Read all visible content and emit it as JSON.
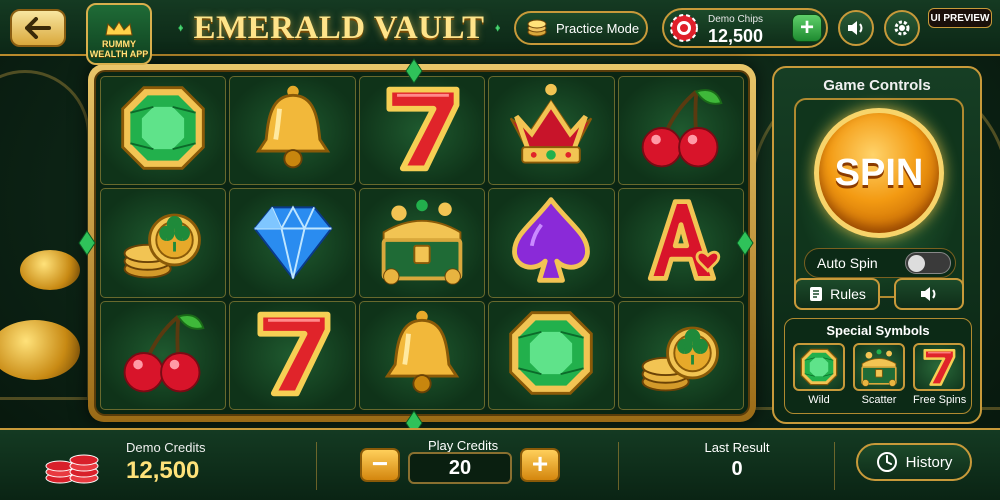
{
  "header": {
    "app_logo_text": "RUMMY WEALTH APP",
    "title": "EMERALD VAULT",
    "practice_label": "Practice Mode",
    "chips_label": "Demo Chips",
    "chips_value": "12,500",
    "preview_badge": "UI PREVIEW"
  },
  "reels": [
    [
      "emerald",
      "bell",
      "seven",
      "crown",
      "cherry"
    ],
    [
      "coins",
      "diamond",
      "treasure-chest",
      "spade",
      "ace"
    ],
    [
      "cherry",
      "seven",
      "bell",
      "emerald",
      "coins"
    ]
  ],
  "controls": {
    "title": "Game Controls",
    "spin_label": "SPIN",
    "autospin_label": "Auto Spin",
    "autospin_on": false,
    "rules_label": "Rules",
    "special_title": "Special Symbols",
    "special_symbols": [
      {
        "label": "Wild",
        "icon": "emerald"
      },
      {
        "label": "Scatter",
        "icon": "treasure-chest"
      },
      {
        "label": "Free Spins",
        "icon": "seven"
      }
    ]
  },
  "footer": {
    "credits_label": "Demo Credits",
    "credits_value": "12,500",
    "play_label": "Play Credits",
    "play_value": "20",
    "last_label": "Last  Result",
    "last_value": "0",
    "history_label": "History"
  },
  "colors": {
    "gold": "#c89a3a",
    "felt_green": "#0f3319",
    "spin_orange": "#f39a12"
  }
}
